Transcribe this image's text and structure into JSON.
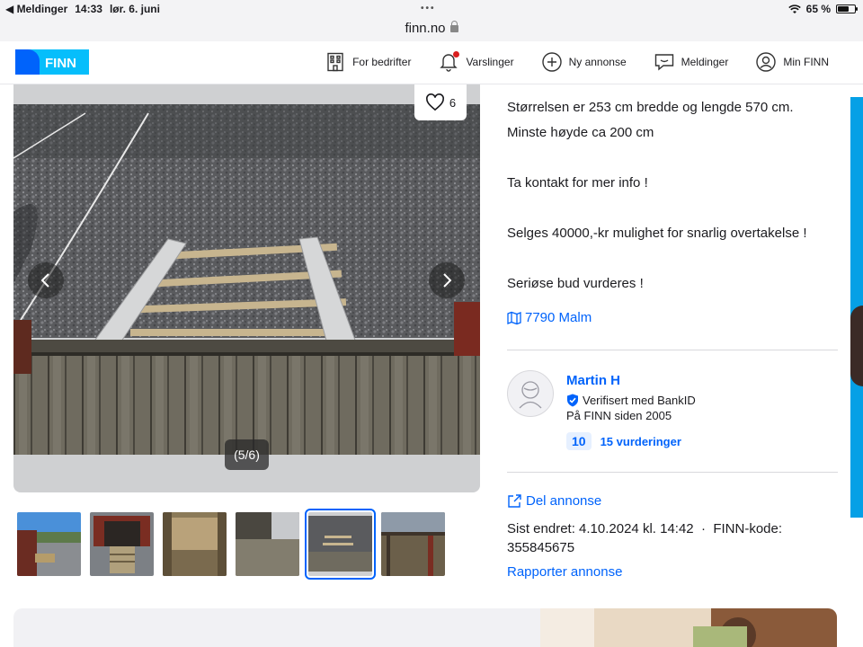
{
  "status_bar": {
    "back_app": "Meldinger",
    "time": "14:33",
    "date": "lør. 6. juni",
    "battery": "65 %",
    "battery_level": 0.65
  },
  "url_bar": {
    "domain": "finn.no"
  },
  "header": {
    "logo_text": "FINN",
    "nav": [
      {
        "label": "For bedrifter",
        "icon": "building-icon"
      },
      {
        "label": "Varslinger",
        "icon": "bell-icon"
      },
      {
        "label": "Ny annonse",
        "icon": "plus-circle-icon"
      },
      {
        "label": "Meldinger",
        "icon": "chat-icon"
      },
      {
        "label": "Min FINN",
        "icon": "user-circle-icon"
      }
    ]
  },
  "gallery": {
    "favorite_count": "6",
    "counter": "(5/6)",
    "thumbnail_count": 6,
    "active_thumbnail": 5
  },
  "description": {
    "lines": [
      "Størrelsen er 253 cm bredde og lengde 570 cm.",
      "Minste høyde ca 200 cm",
      "",
      "Ta kontakt for mer info !",
      "",
      "Selges 40000,-kr mulighet for snarlig overtakelse !",
      "",
      "Seriøse bud vurderes !"
    ]
  },
  "location": {
    "label": "7790 Malm"
  },
  "seller": {
    "name": "Martin H",
    "verified": "Verifisert med BankID",
    "member_since": "På FINN siden 2005",
    "rating_score": "10",
    "rating_count": "15 vurderinger"
  },
  "actions": {
    "share": "Del annonse",
    "report": "Rapporter annonse"
  },
  "meta": {
    "last_changed": "Sist endret: 4.10.2024 kl. 14:42",
    "separator": "·",
    "finn_code": "FINN-kode: 355845675"
  },
  "colors": {
    "brand_blue": "#0063fb",
    "logo_light_blue": "#06befb",
    "edge_blue": "#05a0e6"
  }
}
